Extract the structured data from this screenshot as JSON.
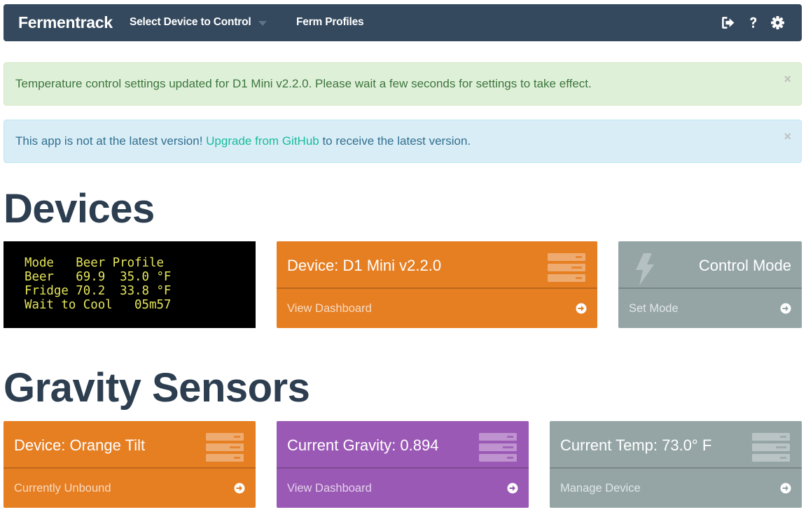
{
  "navbar": {
    "brand": "Fermentrack",
    "device_select": "Select Device to Control",
    "ferm_profiles": "Ferm Profiles",
    "icons": [
      "sign-out-icon",
      "help-icon",
      "gear-icon"
    ]
  },
  "alerts": {
    "success": {
      "text": "Temperature control settings updated for D1 Mini v2.2.0. Please wait a few seconds for settings to take effect.",
      "close": "×"
    },
    "info": {
      "text_before": "This app is not at the latest version! ",
      "link": "Upgrade from GitHub",
      "text_after": " to receive the latest version.",
      "close": "×"
    }
  },
  "devices": {
    "heading": "Devices",
    "lcd_lines": [
      "Mode   Beer Profile",
      "Beer   69.9  35.0 °F",
      "Fridge 70.2  33.8 °F",
      "Wait to Cool   05m57"
    ],
    "device_panel": {
      "title": "Device: D1 Mini v2.2.0",
      "footer": "View Dashboard"
    },
    "mode_panel": {
      "title": "Control Mode",
      "footer": "Set Mode"
    }
  },
  "gravity": {
    "heading": "Gravity Sensors",
    "device_panel": {
      "title": "Device: Orange Tilt",
      "footer": "Currently Unbound"
    },
    "gravity_panel": {
      "title": "Current Gravity: 0.894",
      "footer": "View Dashboard"
    },
    "temp_panel": {
      "title": "Current Temp: 73.0° F",
      "footer": "Manage Device"
    }
  },
  "colors": {
    "navbar": "#34495e",
    "orange": "#e67e22",
    "gray": "#95a5a6",
    "purple": "#9b59b6",
    "lcd_text": "#e5e55c"
  }
}
